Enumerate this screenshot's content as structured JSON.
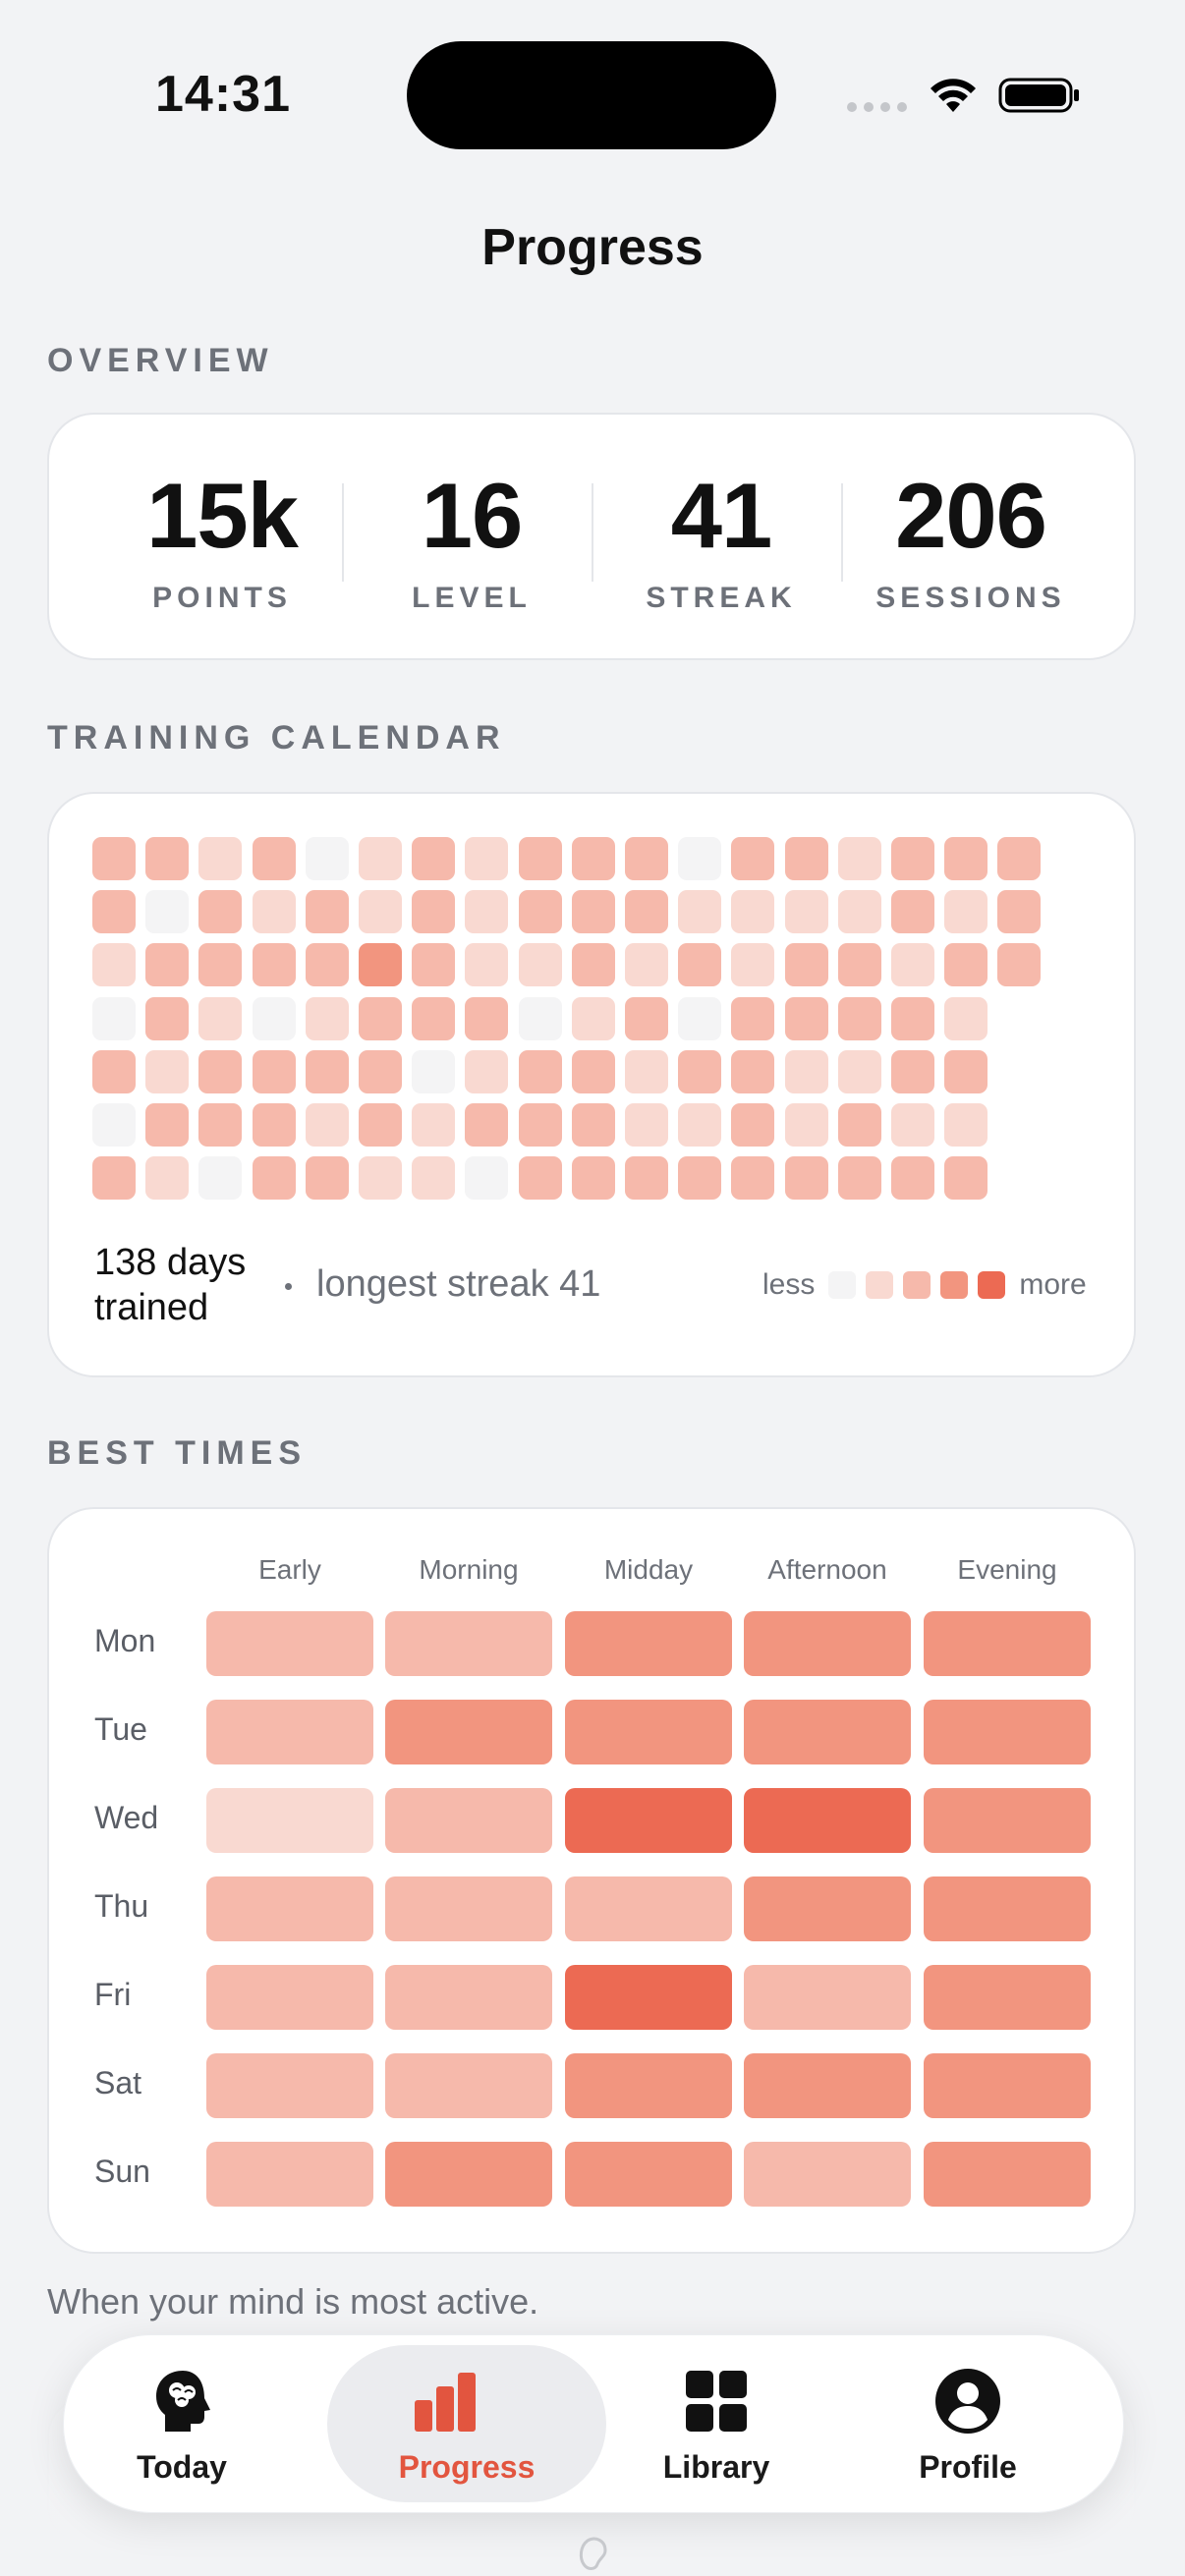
{
  "status_bar": {
    "time": "14:31"
  },
  "page": {
    "title": "Progress"
  },
  "overview": {
    "label": "OVERVIEW",
    "stats": [
      {
        "value": "15k",
        "label": "POINTS"
      },
      {
        "value": "16",
        "label": "LEVEL"
      },
      {
        "value": "41",
        "label": "STREAK"
      },
      {
        "value": "206",
        "label": "SESSIONS"
      }
    ]
  },
  "calendar": {
    "label": "TRAINING CALENDAR",
    "days_trained": "138 days trained",
    "longest_streak": "longest streak 41",
    "legend_less": "less",
    "legend_more": "more",
    "palette": [
      "#f4f4f5",
      "#f9d9d1",
      "#f6b9ab",
      "#f2957f",
      "#ec6a53"
    ],
    "weeks": [
      [
        2,
        2,
        1,
        0,
        2,
        0,
        2
      ],
      [
        2,
        0,
        2,
        2,
        1,
        2,
        1
      ],
      [
        1,
        2,
        2,
        1,
        2,
        2,
        0
      ],
      [
        2,
        1,
        2,
        0,
        2,
        2,
        2
      ],
      [
        0,
        2,
        2,
        1,
        2,
        1,
        2
      ],
      [
        1,
        1,
        3,
        2,
        2,
        2,
        1
      ],
      [
        2,
        2,
        2,
        2,
        0,
        1,
        1
      ],
      [
        1,
        1,
        1,
        2,
        1,
        2,
        0
      ],
      [
        2,
        2,
        1,
        0,
        2,
        2,
        2
      ],
      [
        2,
        2,
        2,
        1,
        2,
        2,
        2
      ],
      [
        2,
        2,
        1,
        2,
        1,
        1,
        2
      ],
      [
        0,
        1,
        2,
        0,
        2,
        1,
        2
      ],
      [
        2,
        1,
        1,
        2,
        2,
        2,
        2
      ],
      [
        2,
        1,
        2,
        2,
        1,
        1,
        2
      ],
      [
        1,
        1,
        2,
        2,
        1,
        2,
        2
      ],
      [
        2,
        2,
        1,
        2,
        2,
        1,
        2
      ],
      [
        2,
        1,
        2,
        1,
        2,
        1,
        2
      ],
      [
        2,
        2,
        2
      ]
    ]
  },
  "best_times": {
    "label": "BEST TIMES",
    "columns": [
      "Early",
      "Morning",
      "Midday",
      "Afternoon",
      "Evening"
    ],
    "rows": [
      {
        "day": "Mon",
        "levels": [
          2,
          2,
          3,
          3,
          3
        ]
      },
      {
        "day": "Tue",
        "levels": [
          2,
          3,
          3,
          3,
          3
        ]
      },
      {
        "day": "Wed",
        "levels": [
          1,
          2,
          4,
          4,
          3
        ]
      },
      {
        "day": "Thu",
        "levels": [
          2,
          2,
          2,
          3,
          3
        ]
      },
      {
        "day": "Fri",
        "levels": [
          2,
          2,
          4,
          2,
          3
        ]
      },
      {
        "day": "Sat",
        "levels": [
          2,
          2,
          3,
          3,
          3
        ]
      },
      {
        "day": "Sun",
        "levels": [
          2,
          3,
          3,
          2,
          3
        ]
      }
    ],
    "caption": "When your mind is most active."
  },
  "tab_bar": {
    "tabs": [
      {
        "label": "Today",
        "icon": "head-brain-icon"
      },
      {
        "label": "Progress",
        "icon": "bar-chart-icon"
      },
      {
        "label": "Library",
        "icon": "grid-icon"
      },
      {
        "label": "Profile",
        "icon": "person-circle-icon"
      }
    ],
    "accent": "#e2553f"
  }
}
